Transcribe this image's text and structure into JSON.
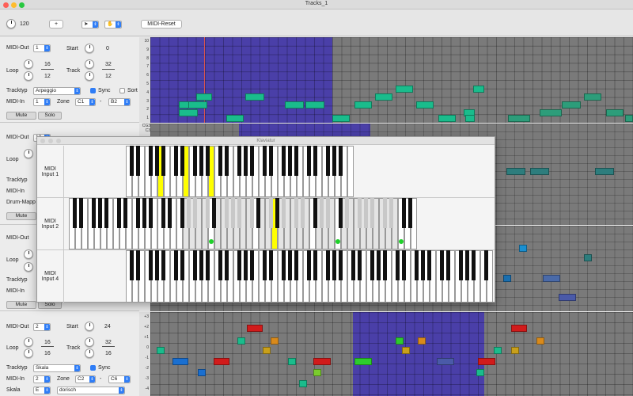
{
  "window": {
    "title": "Tracks_1"
  },
  "toolbar": {
    "tempo": "120",
    "plus_label": "+",
    "midi_reset_label": "MIDI-Reset"
  },
  "tracks": [
    {
      "midi_out_label": "MIDI-Out",
      "midi_out": "1",
      "start_label": "Start",
      "start": "0",
      "loop_label": "Loop",
      "loop_num": "16",
      "loop_den": "12",
      "track_label": "Track",
      "track_num": "32",
      "track_den": "12",
      "tracktyp_label": "Tracktyp",
      "tracktyp": "Arpeggio",
      "sync_label": "Sync",
      "sort_label": "Sort",
      "midi_in_label": "MIDI-In",
      "midi_in": "1",
      "zone_label": "Zone",
      "zone_from": "C1",
      "zone_sep": "-",
      "zone_to": "B2",
      "mute_label": "Mute",
      "solo_label": "Solo"
    },
    {
      "midi_out_label": "MIDI-Out",
      "midi_out": "12",
      "loop_label": "Loop",
      "tracktyp_label": "Tracktyp",
      "midi_in_label": "MIDI-In",
      "drum_label": "Drum-Mapp",
      "mute_label": "Mute"
    },
    {
      "midi_out_label": "MIDI-Out",
      "loop_label": "Loop",
      "tracktyp_label": "Tracktyp",
      "midi_in_label": "MIDI-In",
      "mute_label": "Mute",
      "solo_label": "Solo"
    },
    {
      "midi_out_label": "MIDI-Out",
      "midi_out": "2",
      "start_label": "Start",
      "start": "24",
      "loop_label": "Loop",
      "loop_num": "16",
      "loop_den": "16",
      "track_label": "Track",
      "track_num": "32",
      "track_den": "16",
      "tracktyp_label": "Tracktyp",
      "tracktyp": "Skala",
      "sync_label": "Sync",
      "midi_in_label": "MIDI-In",
      "midi_in": "2",
      "zone_label": "Zone",
      "zone_from": "C2",
      "zone_sep": "-",
      "zone_to": "C6",
      "skala_label": "Skala",
      "skala_root": "E",
      "skala_mode": "dorisch"
    }
  ],
  "rows_top": [
    "10",
    "9",
    "8",
    "7",
    "6",
    "5",
    "4",
    "3",
    "2",
    "1"
  ],
  "rows_mid": [
    "CG3",
    "C3"
  ],
  "rows_bottom": [
    "+3",
    "+2",
    "+1",
    "0",
    "-1",
    "-2",
    "-3",
    "-4"
  ],
  "keyboard": {
    "title": "Klaviatur",
    "rows": [
      {
        "label_line1": "MIDI",
        "label_line2": "Input 1"
      },
      {
        "label_line1": "MIDI",
        "label_line2": "Input 2"
      },
      {
        "label_line1": "MIDI",
        "label_line2": "Input 4"
      }
    ]
  },
  "colors": {
    "accent": "#2f7df6",
    "note_teal": "#1abc8c",
    "loop_region": "#4a3fa8",
    "highlight_key": "#ffff00",
    "playhead": "#d9534f"
  }
}
